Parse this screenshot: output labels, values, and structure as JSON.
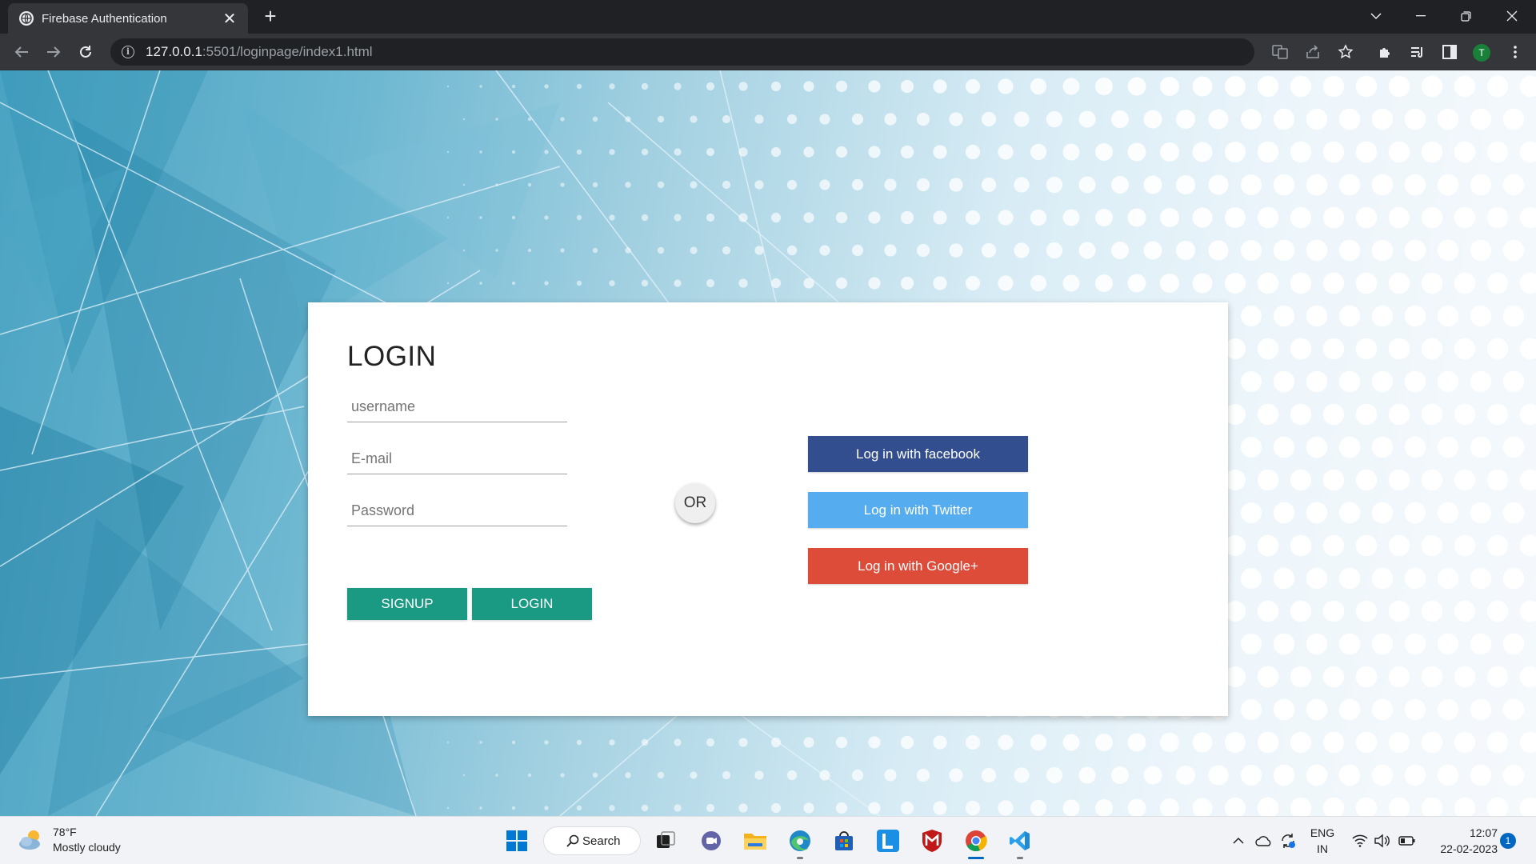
{
  "browser": {
    "tab_title": "Firebase Authentication",
    "tab_close": "✕",
    "new_tab": "+",
    "url_host": "127.0.0.1",
    "url_path": ":5501/loginpage/index1.html",
    "profile_initial": "T"
  },
  "login": {
    "title": "LOGIN",
    "username_placeholder": "username",
    "email_placeholder": "E-mail",
    "password_placeholder": "Password",
    "signup_label": "SIGNUP",
    "login_label": "LOGIN",
    "or_label": "OR"
  },
  "social": {
    "facebook_label": "Log in with facebook",
    "twitter_label": "Log in with Twitter",
    "google_label": "Log in with Google+",
    "facebook_color": "#334e8f",
    "twitter_color": "#55acee",
    "google_color": "#dd4b39"
  },
  "taskbar": {
    "weather_temp": "78°F",
    "weather_desc": "Mostly cloudy",
    "search_label": "Search",
    "lang_top": "ENG",
    "lang_bottom": "IN",
    "time": "12:07",
    "date": "22-02-2023",
    "notification_count": "1"
  },
  "colors": {
    "accent_teal": "#1a9a82",
    "chrome_dark": "#202124"
  }
}
